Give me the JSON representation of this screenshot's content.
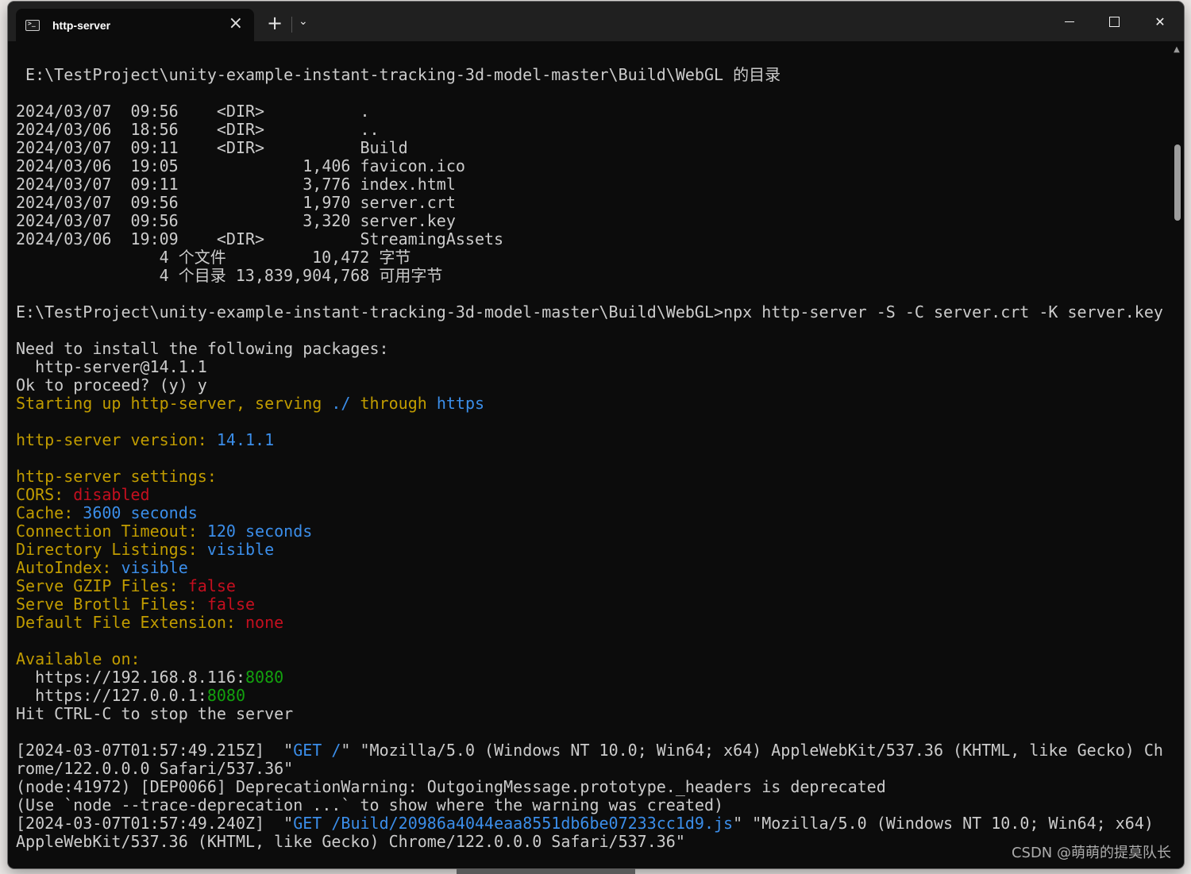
{
  "window": {
    "tab_title": "http-server",
    "tab_icon": "terminal-icon",
    "new_tab_label": "+",
    "dropdown_icon": "chevron-down-icon",
    "close_tab_icon": "close-icon"
  },
  "colors": {
    "background": "#0c0c0c",
    "text": "#cccccc",
    "yellow": "#c19c00",
    "blue": "#3b8eea",
    "red": "#c50f1f",
    "green": "#13a10e"
  },
  "terminal": {
    "l00": " E:\\TestProject\\unity-example-instant-tracking-3d-model-master\\Build\\WebGL 的目录",
    "l01": "",
    "l02": "2024/03/07  09:56    <DIR>          .",
    "l03": "2024/03/06  18:56    <DIR>          ..",
    "l04": "2024/03/07  09:11    <DIR>          Build",
    "l05": "2024/03/06  19:05             1,406 favicon.ico",
    "l06": "2024/03/07  09:11             3,776 index.html",
    "l07": "2024/03/07  09:56             1,970 server.crt",
    "l08": "2024/03/07  09:56             3,320 server.key",
    "l09": "2024/03/06  19:09    <DIR>          StreamingAssets",
    "l10": "               4 个文件         10,472 字节",
    "l11": "               4 个目录 13,839,904,768 可用字节",
    "l12": "",
    "l13": "E:\\TestProject\\unity-example-instant-tracking-3d-model-master\\Build\\WebGL>npx http-server -S -C server.crt -K server.key",
    "l14": "",
    "l15": "Need to install the following packages:",
    "l16": "  http-server@14.1.1",
    "l17": "Ok to proceed? (y) y",
    "l18a": "Starting up http-server, serving ",
    "l18b": "./",
    "l18c": " through ",
    "l18d": "https",
    "l19": "",
    "l20a": "http-server version: ",
    "l20b": "14.1.1",
    "l21": "",
    "l22": "http-server settings:",
    "l23a": "CORS: ",
    "l23b": "disabled",
    "l24a": "Cache: ",
    "l24b": "3600 seconds",
    "l25a": "Connection Timeout: ",
    "l25b": "120 seconds",
    "l26a": "Directory Listings: ",
    "l26b": "visible",
    "l27a": "AutoIndex: ",
    "l27b": "visible",
    "l28a": "Serve GZIP Files: ",
    "l28b": "false",
    "l29a": "Serve Brotli Files: ",
    "l29b": "false",
    "l30a": "Default File Extension: ",
    "l30b": "none",
    "l31": "",
    "l32": "Available on:",
    "l33a": "  https://192.168.8.116:",
    "l33b": "8080",
    "l34a": "  https://127.0.0.1:",
    "l34b": "8080",
    "l35": "Hit CTRL-C to stop the server",
    "l36": "",
    "l37a": "[2024-03-07T01:57:49.215Z]  \"",
    "l37b": "GET /",
    "l37c": "\" \"Mozilla/5.0 (Windows NT 10.0; Win64; x64) AppleWebKit/537.36 (KHTML, like Gecko) Ch",
    "l38": "rome/122.0.0.0 Safari/537.36\"",
    "l39": "(node:41972) [DEP0066] DeprecationWarning: OutgoingMessage.prototype._headers is deprecated",
    "l40": "(Use `node --trace-deprecation ...` to show where the warning was created)",
    "l41a": "[2024-03-07T01:57:49.240Z]  \"",
    "l41b": "GET /Build/20986a4044eaa8551db6be07233cc1d9.js",
    "l41c": "\" \"Mozilla/5.0 (Windows NT 10.0; Win64; x64)",
    "l42": "AppleWebKit/537.36 (KHTML, like Gecko) Chrome/122.0.0.0 Safari/537.36\""
  },
  "watermark": "CSDN @萌萌的提莫队长"
}
